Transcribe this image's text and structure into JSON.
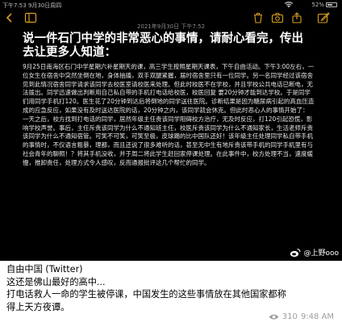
{
  "status_bar": {
    "time": "下午7:53  9月30日周四",
    "battery": "52%"
  },
  "note": {
    "date": "2021年9月30日 下午7:52",
    "title": "说一件石门中学的非常恶心的事情，请耐心看完，传出去让更多人知道：",
    "body": "9月25日南海区石门中学星期六补星期天的课，高三学生按照星期天课表，下午自由活动。下午3:00左右，一位女生在宿舍中突然坐倒在地，身体抽搐，双手双腿紧握，届时宿舍里只有一位同学。另一名同学经过该宿舍见到此情况宿舍同学请求该同学去校医室请校医来处理。但此时校医不在学校，并且学校公共电话已断电，无法拨出。同学迅速做出判断用自己私自带的手机打电话给校医，校医回复 要20分钟才能到达学校。于是同学们用同学手机打120。医生花了20分钟到达后将倒地的同学送往医院。诊断结果是因为糖尿病引起的高血压造成的应急反应，如果没有及时送达医院的话，20分钟之内，该同学就会休克。但此时恶心人的事情开始了：一天之后，校方找到打电话的同学，居然年级主任责该同学阻碍校方治疗，无及时反应，打120引起恐慌，影响学校声誉。事后，主任斥责该同学为什么不通知班主任，校医斥责该同学为什么不通知家长，生活老师斥责该同学为什么不通知宿管。可笑不可笑，可笑至极，皮球踢的比中国队还好！该年级主任处理同学私自带手机的事情时，不仅语言粗暴，理都，而且还说了很多难听的话，甚至无中生有地斥责该带手机的同学手机里有与社会青年的聊照！？将其手机没收，并于周二将此学生赶回家停课处理。在此事件中，校方处理不当，速度缓慢，推卸责任，处理方式令人感叹，反而通报批评这几个帮忙的同学。"
  },
  "watermark": {
    "text": "@上野ooo"
  },
  "tweet": {
    "source": "自由中国 (Twitter)",
    "lines": [
      "这还是佛山最好的高中...",
      "打电话救人一命的学生被停课，中国发生的这些事情放在其他国家都称",
      "得上天方夜谭。"
    ],
    "views": "310",
    "time": "9:48 AM"
  }
}
